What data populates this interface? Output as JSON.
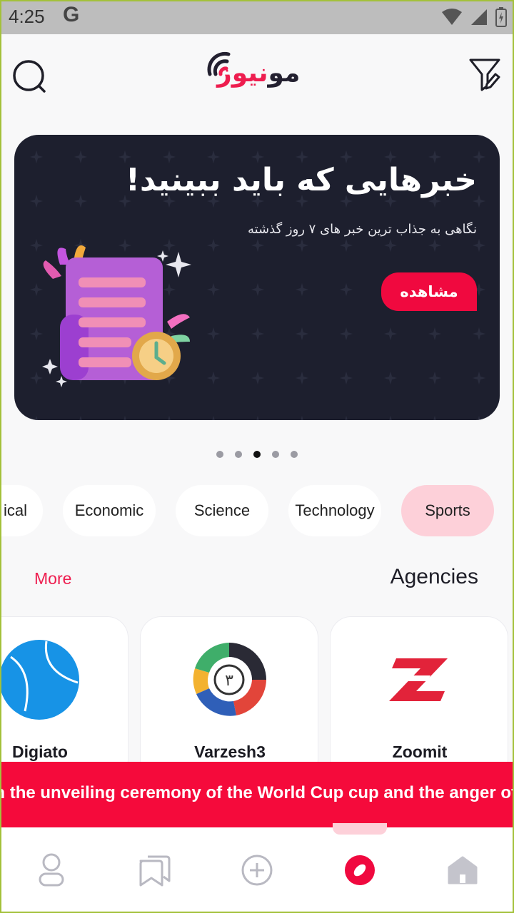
{
  "status_bar": {
    "time": "4:25",
    "google_letter": "G",
    "icons": [
      "wifi-icon",
      "signal-icon",
      "battery-icon"
    ]
  },
  "header": {
    "logo_text_dark": "مو",
    "logo_text_red": "نیوز",
    "left_icon": "search-icon",
    "right_icon": "filter-edit-icon"
  },
  "banner": {
    "title": "خبرهایی که باید ببینید!",
    "subtitle": "نگاهی به جذاب ترین خبر های ۷ روز گذشته",
    "button_label": "مشاهده",
    "illustration": "newspaper-clock-illustration"
  },
  "carousel": {
    "count": 5,
    "active_index": 2
  },
  "categories": {
    "items": [
      "ical",
      "Economic",
      "Science",
      "Technology",
      "Sports"
    ],
    "selected": "Sports"
  },
  "agencies": {
    "title": "Agencies",
    "more_label": "More",
    "items": [
      {
        "name": "Digiato",
        "logo": "digiato-logo"
      },
      {
        "name": "Varzesh3",
        "logo": "varzesh3-logo"
      },
      {
        "name": "Zoomit",
        "logo": "zoomit-logo"
      }
    ]
  },
  "ticker": {
    "text": "er in the unveiling ceremony of the World Cup cup and the anger of"
  },
  "bottom_nav": {
    "items": [
      "profile-icon",
      "bookmarks-icon",
      "add-icon",
      "live-icon",
      "home-icon"
    ],
    "active": "live-icon"
  },
  "colors": {
    "accent": "#f0093f",
    "banner_bg": "#1d1f2e",
    "chip_selected": "#fdd0d9",
    "ticker_bg": "#f50a3b"
  }
}
